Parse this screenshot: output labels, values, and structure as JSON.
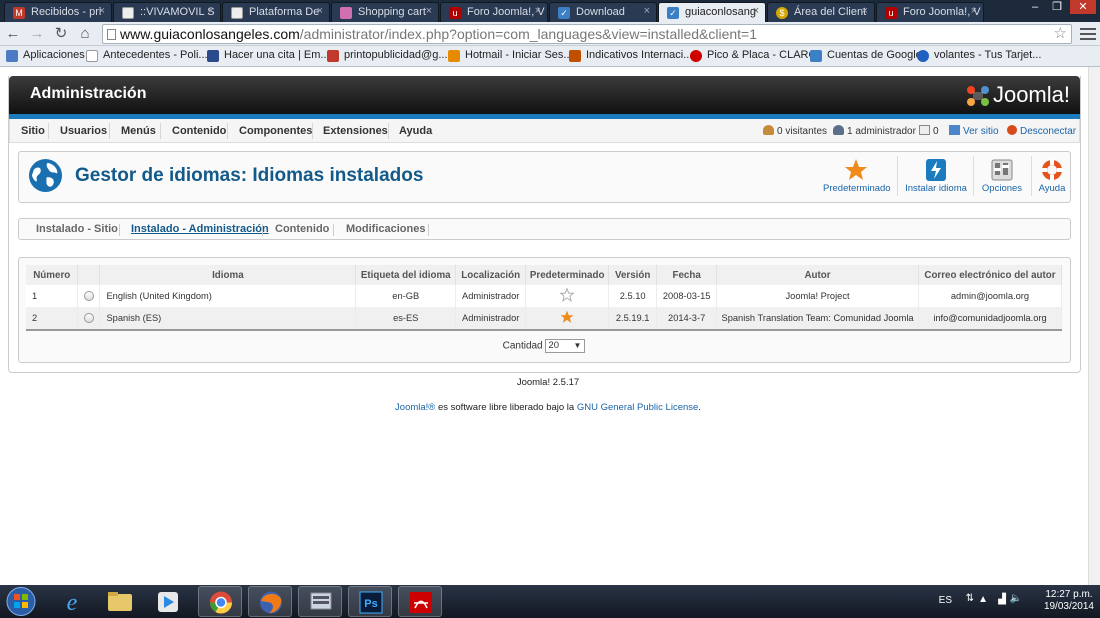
{
  "browser": {
    "tabs": [
      {
        "label": "Recibidos - pri",
        "icon": "gmail-icon",
        "color": "#c0392b"
      },
      {
        "label": "::VIVAMOVIL S",
        "icon": "page-icon",
        "color": "#ffffff"
      },
      {
        "label": "Plataforma De",
        "icon": "page-icon",
        "color": "#ffffff"
      },
      {
        "label": "Shopping cart",
        "icon": "cart-icon",
        "color": "#d070b0"
      },
      {
        "label": "Foro Joomla!, V",
        "icon": "foro-icon",
        "color": "#b00000"
      },
      {
        "label": "Download",
        "icon": "joomla-icon",
        "color": "#3b7fc4"
      },
      {
        "label": "guiaconlosang",
        "icon": "joomla-icon",
        "color": "#3b7fc4"
      },
      {
        "label": "Área del Client",
        "icon": "coin-icon",
        "color": "#d4a800"
      },
      {
        "label": "Foro Joomla!, V",
        "icon": "foro-icon",
        "color": "#b00000"
      }
    ],
    "url_host": "www.guiaconlosangeles.com",
    "url_path": "/administrator/index.php?option=com_languages&view=installed&client=1",
    "bookmarks": [
      {
        "label": "Aplicaciones",
        "color": "#4d7ac4"
      },
      {
        "label": "Antecedentes - Poli...",
        "color": "#ffffff"
      },
      {
        "label": "Hacer una cita | Em...",
        "color": "#2a4a8c"
      },
      {
        "label": "printopublicidad@g...",
        "color": "#c0392b"
      },
      {
        "label": "Hotmail - Iniciar Ses...",
        "color": "#e68a00"
      },
      {
        "label": "Indicativos Internaci...",
        "color": "#c05000"
      },
      {
        "label": "Pico & Placa - CLARO",
        "color": "#d00000"
      },
      {
        "label": "Cuentas de Google",
        "color": "#3b7fc4"
      },
      {
        "label": "volantes - Tus Tarjet...",
        "color": "#2060c0"
      }
    ]
  },
  "admin": {
    "header_title": "Administración",
    "logo_text": "Joomla!",
    "menu": [
      "Sitio",
      "Usuarios",
      "Menús",
      "Contenido",
      "Componentes",
      "Extensiones",
      "Ayuda"
    ],
    "status": {
      "visitors": "0 visitantes",
      "admins": "1 administrador",
      "messages": "0",
      "view_site": "Ver sitio",
      "logout": "Desconectar"
    },
    "page_title": "Gestor de idiomas: Idiomas instalados",
    "toolbar": {
      "default_label": "Predeterminado",
      "install_label": "Instalar idioma",
      "options_label": "Opciones",
      "help_label": "Ayuda"
    },
    "subtabs": [
      "Instalado - Sitio",
      "Instalado - Administración",
      "Contenido",
      "Modificaciones"
    ],
    "table": {
      "headers": [
        "Número",
        "",
        "Idioma",
        "Etiqueta del idioma",
        "Localización",
        "Predeterminado",
        "Versión",
        "Fecha",
        "Autor",
        "Correo electrónico del autor"
      ],
      "rows": [
        {
          "num": "1",
          "language": "English (United Kingdom)",
          "tag": "en-GB",
          "location": "Administrador",
          "default": false,
          "version": "2.5.10",
          "date": "2008-03-15",
          "author": "Joomla! Project",
          "email": "admin@joomla.org"
        },
        {
          "num": "2",
          "language": "Spanish (ES)",
          "tag": "es-ES",
          "location": "Administrador",
          "default": true,
          "version": "2.5.19.1",
          "date": "2014-3-7",
          "author": "Spanish Translation Team: Comunidad Joomla",
          "email": "info@comunidadjoomla.org"
        }
      ],
      "quantity_label": "Cantidad",
      "quantity_value": "20"
    },
    "footer_version": "Joomla! 2.5.17",
    "footer_license_pre": "Joomla!®",
    "footer_license_mid": " es software libre liberado bajo la ",
    "footer_license_link": "GNU General Public License",
    "footer_license_post": "."
  },
  "taskbar": {
    "lang": "ES",
    "time": "12:27 p.m.",
    "date": "19/03/2014"
  },
  "colors": {
    "accent": "#1a7bbf",
    "title": "#135a8a",
    "link": "#1a64a8",
    "star": "#f08a1c"
  }
}
